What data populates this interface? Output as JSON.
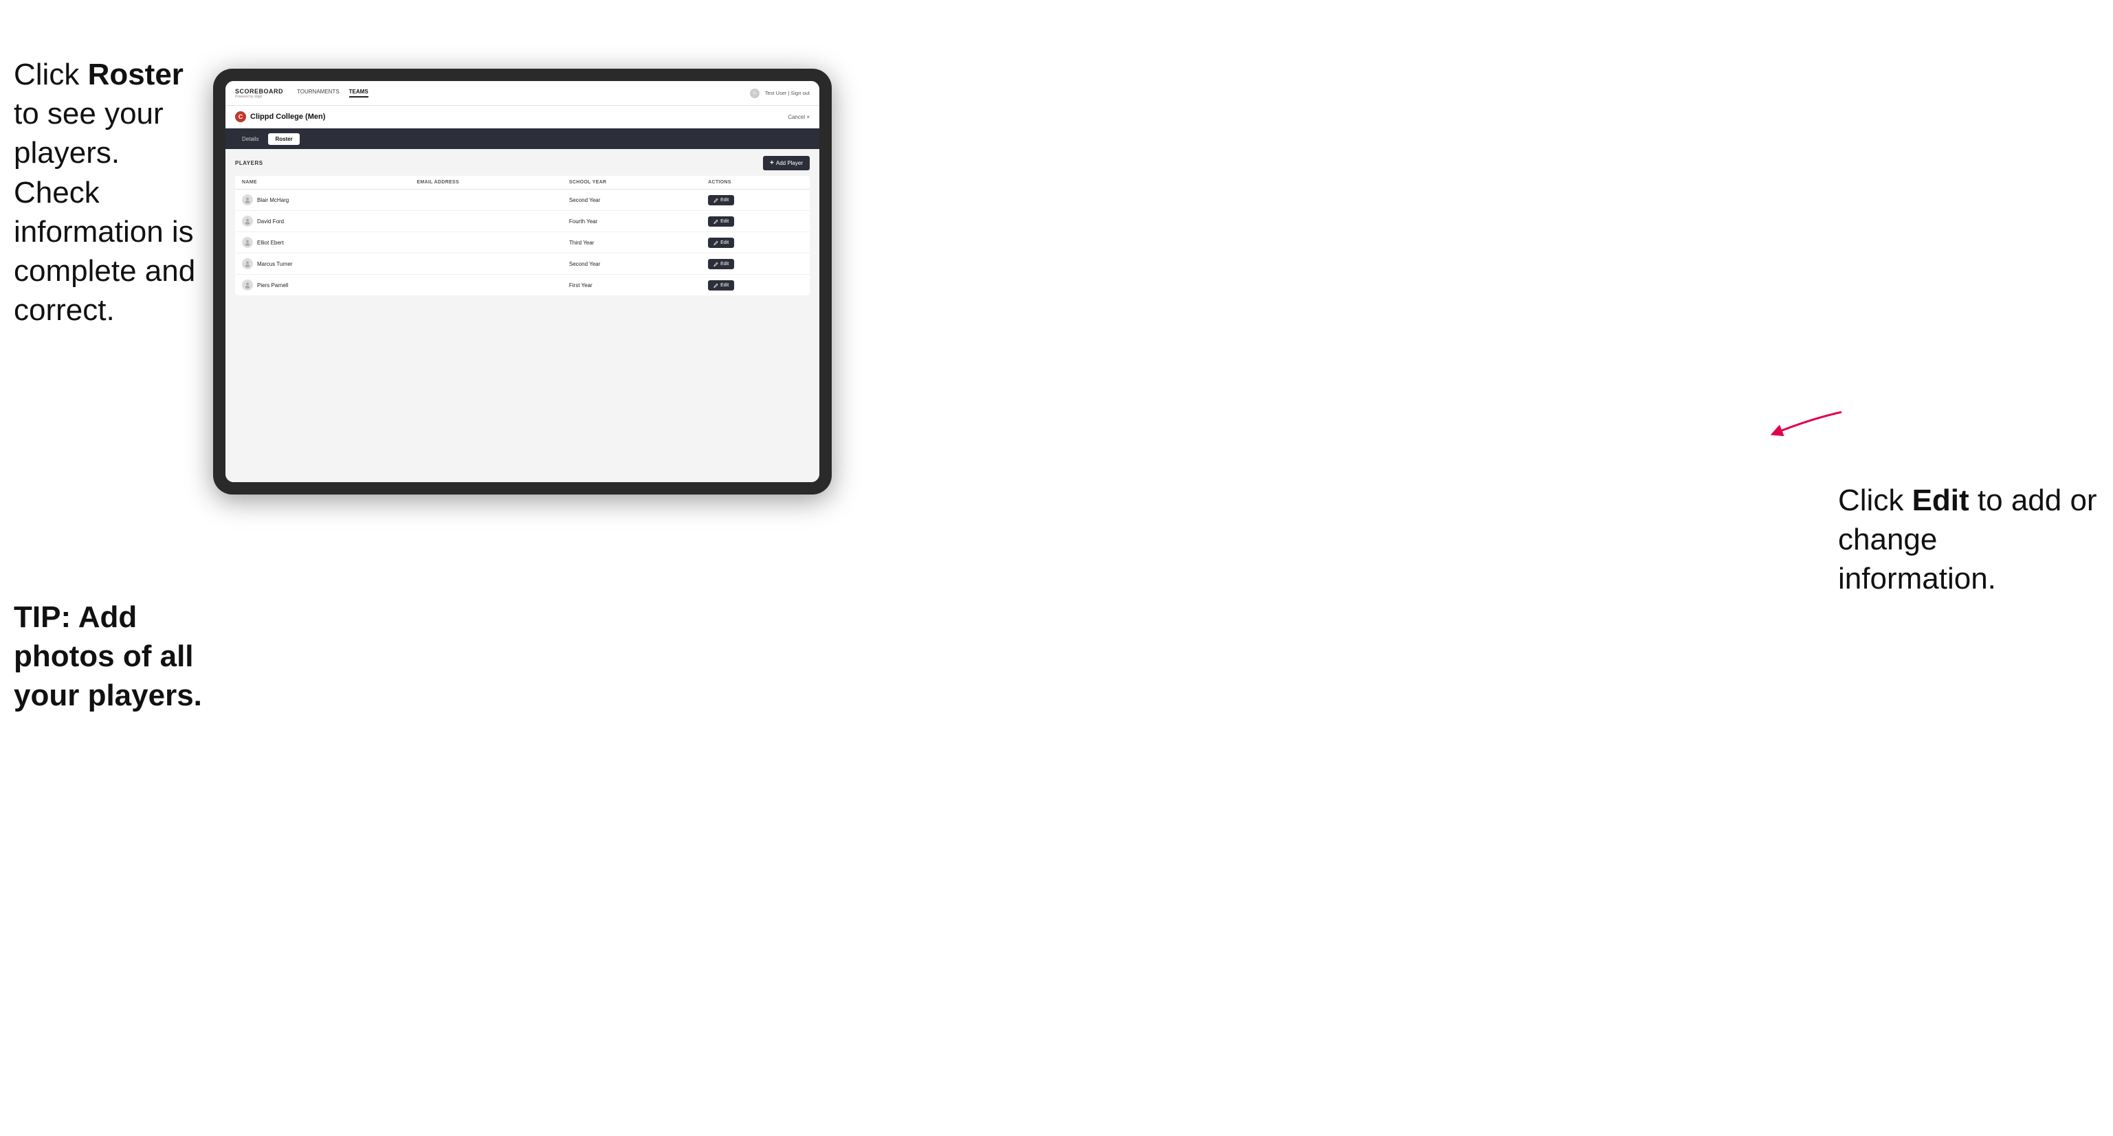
{
  "instructions": {
    "left_text_1": "Click ",
    "left_bold_1": "Roster",
    "left_text_2": " to see your players. Check information is complete and correct.",
    "tip_text": "TIP: Add photos of all your players.",
    "right_text_1": "Click ",
    "right_bold_1": "Edit",
    "right_text_2": " to add or change information."
  },
  "nav": {
    "logo_title": "SCOREBOARD",
    "logo_subtitle": "Powered by clippi",
    "links": [
      "TOURNAMENTS",
      "TEAMS"
    ],
    "active_link": "TEAMS",
    "user_text": "Test User | Sign out"
  },
  "team": {
    "logo_letter": "C",
    "name": "Clippd College (Men)",
    "cancel_label": "Cancel ×"
  },
  "tabs": [
    {
      "label": "Details",
      "active": false
    },
    {
      "label": "Roster",
      "active": true
    }
  ],
  "roster": {
    "section_label": "PLAYERS",
    "add_player_label": "+ Add Player",
    "table": {
      "columns": [
        "NAME",
        "EMAIL ADDRESS",
        "SCHOOL YEAR",
        "ACTIONS"
      ],
      "rows": [
        {
          "name": "Blair McHarg",
          "email": "",
          "school_year": "Second Year"
        },
        {
          "name": "David Ford",
          "email": "",
          "school_year": "Fourth Year"
        },
        {
          "name": "Elliot Ebert",
          "email": "",
          "school_year": "Third Year"
        },
        {
          "name": "Marcus Turner",
          "email": "",
          "school_year": "Second Year"
        },
        {
          "name": "Piers Parnell",
          "email": "",
          "school_year": "First Year"
        }
      ],
      "edit_label": "✎ Edit"
    }
  }
}
